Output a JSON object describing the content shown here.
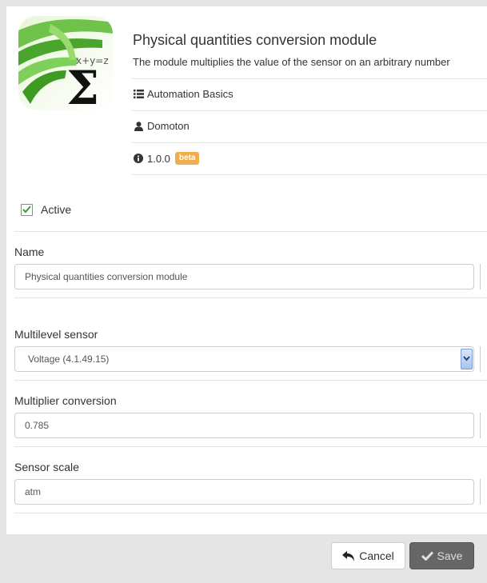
{
  "module": {
    "logo_formula": "x+y=z",
    "logo_symbol": "Σ",
    "title": "Physical quantities conversion module",
    "description": "The module multiplies the value of the sensor on an arbitrary number",
    "category": "Automation Basics",
    "author": "Domoton",
    "version": "1.0.0",
    "version_badge": "beta"
  },
  "icons": {
    "category": "list-icon",
    "author": "user-icon",
    "version": "info-circle-icon",
    "cancel": "undo-arrow-icon",
    "save": "checkmark-icon",
    "active": "checkmark-icon",
    "select_arrow": "chevron-down-icon"
  },
  "form": {
    "active_label": "Active",
    "active_checked": true,
    "name_label": "Name",
    "name_value": "Physical quantities conversion module",
    "sensor_label": "Multilevel sensor",
    "sensor_value": "Voltage (4.1.49.15)",
    "multiplier_label": "Multiplier conversion",
    "multiplier_value": "0.785",
    "scale_label": "Sensor scale",
    "scale_value": "atm"
  },
  "footer": {
    "cancel_label": "Cancel",
    "save_label": "Save"
  },
  "colors": {
    "badge": "#f0ad4e",
    "check": "#3c9a3c",
    "save_button": "#666666"
  }
}
